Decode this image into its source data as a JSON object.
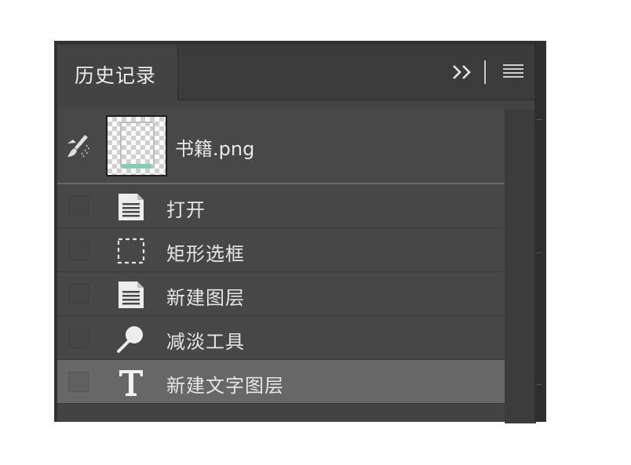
{
  "panel": {
    "tab_title": "历史记录",
    "collapse_icon": "double-chevron-right-icon",
    "menu_icon": "hamburger-menu-icon"
  },
  "snapshot": {
    "source_icon": "history-brush-icon",
    "label": "书籍.png"
  },
  "history": [
    {
      "label": "打开",
      "icon": "document-icon",
      "active": false
    },
    {
      "label": "矩形选框",
      "icon": "rectangular-marquee-icon",
      "active": false
    },
    {
      "label": "新建图层",
      "icon": "document-icon",
      "active": false
    },
    {
      "label": "减淡工具",
      "icon": "dodge-tool-icon",
      "active": false
    },
    {
      "label": "新建文字图层",
      "icon": "type-tool-icon",
      "active": true
    }
  ]
}
